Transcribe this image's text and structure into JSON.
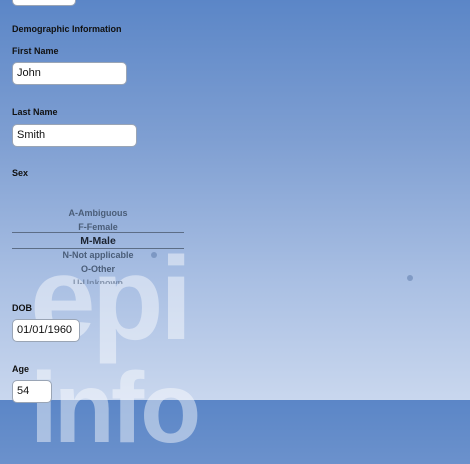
{
  "form": {
    "section_title": "Demographic Information",
    "first_name": {
      "label": "First Name",
      "value": "John"
    },
    "last_name": {
      "label": "Last Name",
      "value": "Smith"
    },
    "sex": {
      "label": "Sex",
      "options": [
        "A-Ambiguous",
        "F-Female",
        "M-Male",
        "N-Not applicable",
        "O-Other",
        "U-Unknown"
      ],
      "selected": "M-Male"
    },
    "dob": {
      "label": "DOB",
      "value": "01/01/1960"
    },
    "age": {
      "label": "Age",
      "value": "54"
    }
  },
  "watermark": {
    "line1": "epi",
    "line2": "info"
  }
}
